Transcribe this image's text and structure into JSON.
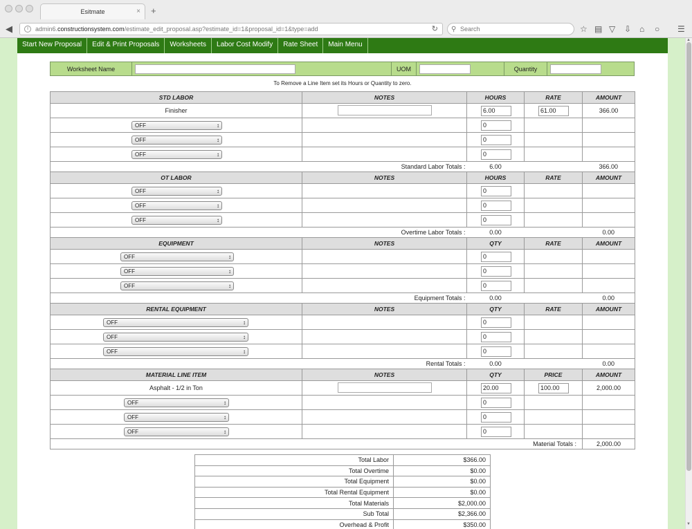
{
  "browser": {
    "tab_title": "Esitmate",
    "tab_close": "×",
    "new_tab": "+",
    "url_host_pre": "admin6.",
    "url_host": "constructionsystem.com",
    "url_path": "/estimate_edit_proposal.asp?estimate_id=1&proposal_id=1&type=add",
    "search_placeholder": "Search"
  },
  "menu": [
    "Start New Proposal",
    "Edit & Print Proposals",
    "Worksheets",
    "Labor Cost Modify",
    "Rate Sheet",
    "Main Menu"
  ],
  "worksheet_bar": {
    "name_label": "Worksheet Name",
    "uom_label": "UOM",
    "qty_label": "Quantity"
  },
  "note": "To Remove a Line Item set its Hours or Quantity to zero.",
  "sections": {
    "std": {
      "h": [
        "STD LABOR",
        "NOTES",
        "HOURS",
        "RATE",
        "AMOUNT"
      ],
      "first": {
        "name": "Finisher",
        "hours": "6.00",
        "rate": "61.00",
        "amount": "366.00"
      },
      "off": [
        "OFF",
        "OFF",
        "OFF"
      ],
      "zero": [
        "0",
        "0",
        "0"
      ],
      "total_label": "Standard Labor Totals :",
      "total_a": "6.00",
      "total_b": "366.00"
    },
    "ot": {
      "h": [
        "OT LABOR",
        "NOTES",
        "HOURS",
        "RATE",
        "AMOUNT"
      ],
      "off": [
        "OFF",
        "OFF",
        "OFF"
      ],
      "zero": [
        "0",
        "0",
        "0"
      ],
      "total_label": "Overtime Labor Totals :",
      "total_a": "0.00",
      "total_b": "0.00"
    },
    "eq": {
      "h": [
        "EQUIPMENT",
        "NOTES",
        "QTY",
        "RATE",
        "AMOUNT"
      ],
      "off": [
        "OFF",
        "OFF",
        "OFF"
      ],
      "zero": [
        "0",
        "0",
        "0"
      ],
      "total_label": "Equipment Totals :",
      "total_a": "0.00",
      "total_b": "0.00"
    },
    "rent": {
      "h": [
        "RENTAL EQUIPMENT",
        "NOTES",
        "QTY",
        "RATE",
        "AMOUNT"
      ],
      "off": [
        "OFF",
        "OFF",
        "OFF"
      ],
      "zero": [
        "0",
        "0",
        "0"
      ],
      "total_label": "Rental Totals :",
      "total_a": "0.00",
      "total_b": "0.00"
    },
    "mat": {
      "h": [
        "MATERIAL LINE ITEM",
        "NOTES",
        "QTY",
        "PRICE",
        "AMOUNT"
      ],
      "first": {
        "name": "Asphalt - 1/2 in Ton",
        "hours": "20.00",
        "rate": "100.00",
        "amount": "2,000.00"
      },
      "off": [
        "OFF",
        "OFF",
        "OFF"
      ],
      "zero": [
        "0",
        "0",
        "0"
      ],
      "total_label": "Material Totals :",
      "total_b": "2,000.00"
    }
  },
  "summary": [
    {
      "label": "Total Labor",
      "value": "$366.00"
    },
    {
      "label": "Total Overtime",
      "value": "$0.00"
    },
    {
      "label": "Total Equipment",
      "value": "$0.00"
    },
    {
      "label": "Total Rental Equipment",
      "value": "$0.00"
    },
    {
      "label": "Total Materials",
      "value": "$2,000.00"
    },
    {
      "label": "Sub Total",
      "value": "$2,366.00"
    },
    {
      "label": "Overhead & Profit",
      "value": "$350.00"
    }
  ]
}
